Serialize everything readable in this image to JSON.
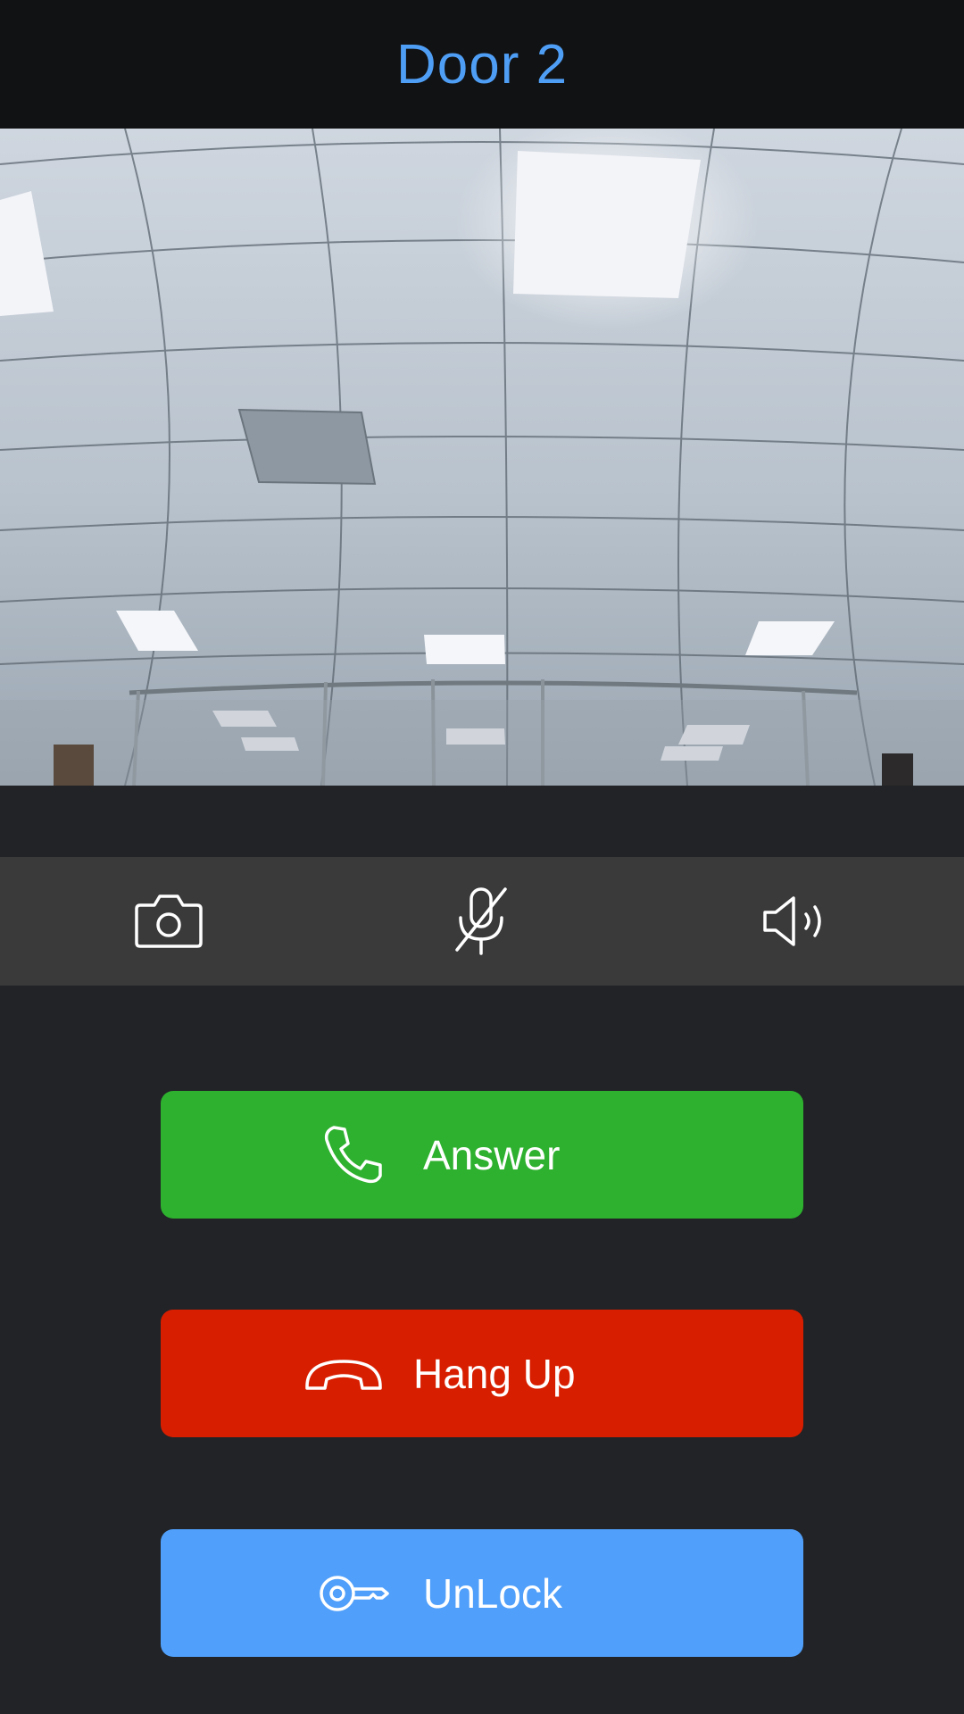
{
  "header": {
    "title": "Door 2"
  },
  "toolbar": {
    "items": [
      {
        "icon": "camera-icon"
      },
      {
        "icon": "microphone-muted-icon"
      },
      {
        "icon": "speaker-icon"
      }
    ]
  },
  "actions": {
    "answer": {
      "label": "Answer",
      "icon": "phone-icon",
      "color": "#2db12e"
    },
    "hangup": {
      "label": "Hang Up",
      "icon": "hang-up-icon",
      "color": "#d81e00"
    },
    "unlock": {
      "label": "UnLock",
      "icon": "key-icon",
      "color": "#509ffa"
    }
  },
  "colors": {
    "accent": "#4f9ef5",
    "background": "#212326",
    "header_background": "#111213",
    "toolbar_background": "#3a3a3b"
  }
}
